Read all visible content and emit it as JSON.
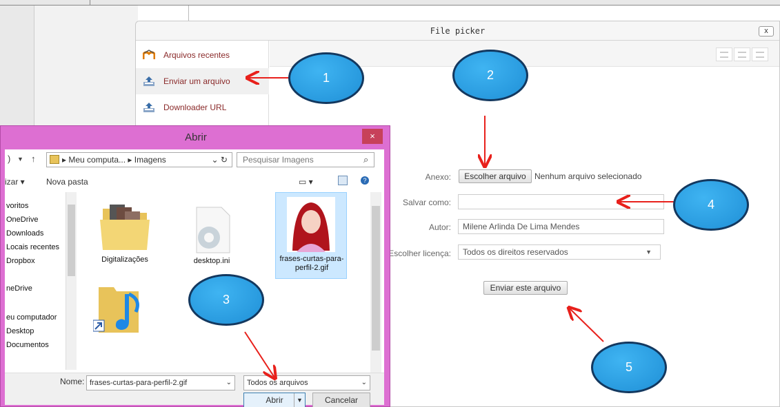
{
  "file_picker": {
    "title": "File picker",
    "close_label": "x",
    "repos": [
      {
        "label": "Arquivos recentes",
        "icon": "moodle-icon"
      },
      {
        "label": "Enviar um arquivo",
        "icon": "upload-icon"
      },
      {
        "label": "Downloader URL",
        "icon": "download-url-icon"
      }
    ],
    "form": {
      "attachment_label": "Anexo:",
      "choose_file_label": "Escolher arquivo",
      "no_file_label": "Nenhum arquivo selecionado",
      "save_as_label": "Salvar como:",
      "save_as_value": "",
      "author_label": "Autor:",
      "author_value": "Milene Arlinda De Lima Mendes",
      "license_label": "Escolher licença:",
      "license_value": "Todos os direitos reservados",
      "submit_label": "Enviar este arquivo"
    }
  },
  "open_dialog": {
    "title": "Abrir",
    "close_label": "×",
    "path": [
      "Meu computa...",
      "Imagens"
    ],
    "search_placeholder": "Pesquisar Imagens",
    "organize_label": "izar ▾",
    "new_folder_label": "Nova pasta",
    "nav_items": [
      "voritos",
      "OneDrive",
      "Downloads",
      "Locais recentes",
      "Dropbox",
      "neDrive",
      "eu computador",
      "Desktop",
      "Documentos"
    ],
    "files": [
      {
        "name": "Digitalizações"
      },
      {
        "name": "desktop.ini"
      },
      {
        "name": "frases-curtas-para-perfil-2.gif"
      }
    ],
    "filename_label": "Nome:",
    "filename_value": "frases-curtas-para-perfil-2.gif",
    "filetype_value": "Todos os arquivos",
    "open_label": "Abrir",
    "cancel_label": "Cancelar"
  },
  "callouts": [
    "1",
    "2",
    "3",
    "4",
    "5"
  ],
  "colors": {
    "arrow": "#e8201b",
    "callout": "#2299e0",
    "dialog_frame": "#dd6fd2"
  }
}
